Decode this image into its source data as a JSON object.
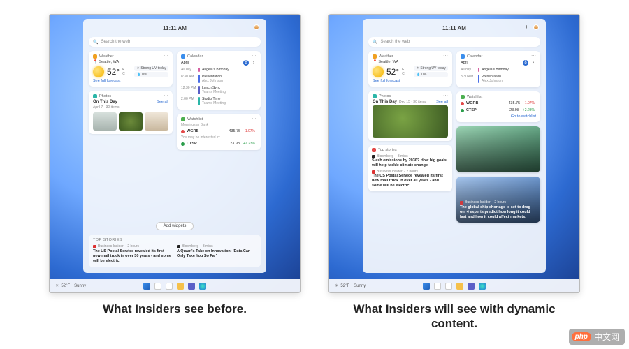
{
  "captions": {
    "before": "What Insiders see before.",
    "after": "What Insiders will see with dynamic content."
  },
  "clock": "11:11 AM",
  "search": {
    "placeholder": "Search the web"
  },
  "weather": {
    "title": "Weather",
    "location": "Seattle, WA",
    "temp": "52°",
    "unit_f": "F",
    "unit_c": "C",
    "cond": "Strong UV today",
    "cond_pct": "0%",
    "link": "See full forecast"
  },
  "calendar": {
    "title": "Calendar",
    "month": "April",
    "day_label": "8",
    "allday": "All day",
    "events": [
      {
        "time": "All day",
        "title": "Angela's Birthday",
        "sub": "",
        "color": "#d65fa1"
      },
      {
        "time": "8:30 AM",
        "title": "Presentation",
        "sub": "Alex Johnson",
        "color": "#4b6fe6"
      },
      {
        "time": "12:30 PM",
        "title": "Lunch Sync",
        "sub": "Teams Meeting",
        "color": "#5b5fc7"
      },
      {
        "time": "2:00 PM",
        "title": "Studio Time",
        "sub": "Teams Meeting",
        "color": "#2bb6a8"
      }
    ]
  },
  "photos": {
    "title": "Photos",
    "heading": "On This Day",
    "sub_before": "April 7 · 30 items",
    "sub_after": "Dec 15 · 30 items",
    "seeall": "See all"
  },
  "watchlist": {
    "title": "Watchlist",
    "source": "Morningstar Bank",
    "rows": [
      {
        "sym": "WGRB",
        "price": "435.75",
        "pct": "-1.07%",
        "dir": "neg"
      },
      {
        "sym": "CTSP",
        "price": "23.98",
        "pct": "+2.23%",
        "dir": "pos"
      }
    ],
    "interest": "You may be interested in:",
    "link": "Go to watchlist"
  },
  "addwidgets": "Add widgets",
  "topstories": {
    "title": "TOP STORIES",
    "title2": "Top stories",
    "items": [
      {
        "src": "Business Insider",
        "age": "2 hours",
        "icon": "bi",
        "headline": "The US Postal Service revealed its first new mail truck in over 30 years - and some will be electric"
      },
      {
        "src": "Bloomberg",
        "age": "3 mins",
        "icon": "bb",
        "headline": "A Quant's Take on Innovation: 'Data Can Only Take You So Far'"
      }
    ],
    "feature": {
      "src": "Bloomberg",
      "age": "3 mins",
      "icon": "bb",
      "headline": "Slash emissions by 2030? How big goals will help tackle climate change"
    }
  },
  "newscards": [
    {
      "src": "Business Insider",
      "age": "2 hours",
      "headline": "The global chip shortage is set to drag on. 4 experts predict how long it could last and how it could affect markets."
    }
  ],
  "taskbar": {
    "temp": "52°F",
    "cond": "Sunny"
  },
  "watermark": {
    "badge": "php",
    "text": "中文网"
  }
}
